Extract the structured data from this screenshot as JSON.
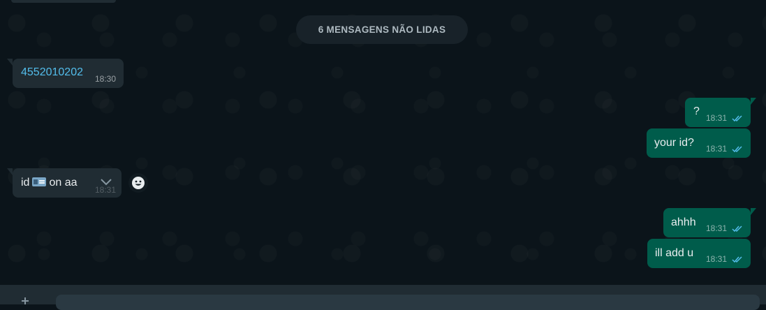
{
  "unread_separator": "6 MENSAGENS NÃO LIDAS",
  "messages": [
    {
      "direction": "in",
      "text": "4552010202",
      "time": "18:30",
      "is_link": true
    },
    {
      "direction": "out",
      "text": "?",
      "time": "18:31",
      "status": "read"
    },
    {
      "direction": "out",
      "text": "your id?",
      "time": "18:31",
      "status": "read"
    },
    {
      "direction": "in",
      "text_before": "id",
      "icon": "id-card-emoji",
      "text_after": "on aa",
      "time": "18:31"
    },
    {
      "direction": "out",
      "text": "ahhh",
      "time": "18:31",
      "status": "read"
    },
    {
      "direction": "out",
      "text": "ill add u",
      "time": "18:31",
      "status": "read"
    }
  ],
  "colors": {
    "background": "#0b141a",
    "incoming_bubble": "#202c33",
    "outgoing_bubble": "#005c4b",
    "read_ticks": "#53bdeb",
    "link": "#53bdeb"
  },
  "icons": {
    "read_receipt": "double-check-icon",
    "message_menu": "chevron-down-icon",
    "reaction": "emoji-icon"
  }
}
